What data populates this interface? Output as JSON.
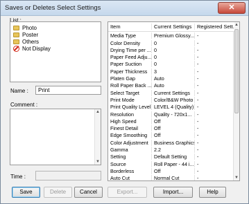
{
  "window": {
    "title": "Saves or Deletes Select Settings",
    "close_glyph": "✕"
  },
  "list": {
    "label": "List :",
    "items": [
      {
        "label": "Photo",
        "icon": "folder-icon"
      },
      {
        "label": "Poster",
        "icon": "folder-icon"
      },
      {
        "label": "Others",
        "icon": "folder-icon"
      },
      {
        "label": "Not Display",
        "icon": "no-display-icon"
      }
    ]
  },
  "name": {
    "label": "Name :",
    "value": "Print"
  },
  "comment": {
    "label": "Comment :",
    "value": ""
  },
  "time": {
    "label": "Time :",
    "value": ""
  },
  "settings_table": {
    "columns": [
      "Item",
      "Current Settings",
      "Registered Sett..."
    ],
    "rows": [
      [
        "Media Type",
        "Premium Glossy...",
        "-"
      ],
      [
        "Color Density",
        "0",
        "-"
      ],
      [
        "Drying Time per ...",
        "0",
        "-"
      ],
      [
        "Paper Feed Adju...",
        "0",
        "-"
      ],
      [
        "Paper Suction",
        "0",
        "-"
      ],
      [
        "Paper Thickness",
        "3",
        "-"
      ],
      [
        "Platen Gap",
        "Auto",
        "-"
      ],
      [
        "Roll Paper Back ...",
        "Auto",
        "-"
      ],
      [
        "Select Target",
        "Current Settings",
        "-"
      ],
      [
        "Print Mode",
        "Color/B&W Photo",
        "-"
      ],
      [
        "Print Quality Level",
        "LEVEL 4 (Quality)",
        "-"
      ],
      [
        "Resolution",
        "Quality - 720x1...",
        "-"
      ],
      [
        "High Speed",
        "Off",
        "-"
      ],
      [
        "Finest Detail",
        "Off",
        "-"
      ],
      [
        "Edge Smoothing",
        "Off",
        "-"
      ],
      [
        "Color Adjustment",
        "Business Graphics",
        "-"
      ],
      [
        "Gamma",
        "2.2",
        "-"
      ],
      [
        "Setting",
        "Default Setting",
        "-"
      ],
      [
        "Source",
        "Roll Paper - 44 i...",
        "-"
      ],
      [
        "Borderless",
        "Off",
        "-"
      ],
      [
        "Auto Cut",
        "Normal Cut",
        "-"
      ]
    ]
  },
  "buttons": {
    "save": "Save",
    "delete": "Delete",
    "cancel": "Cancel",
    "export": "Export...",
    "import": "Import...",
    "help": "Help"
  }
}
